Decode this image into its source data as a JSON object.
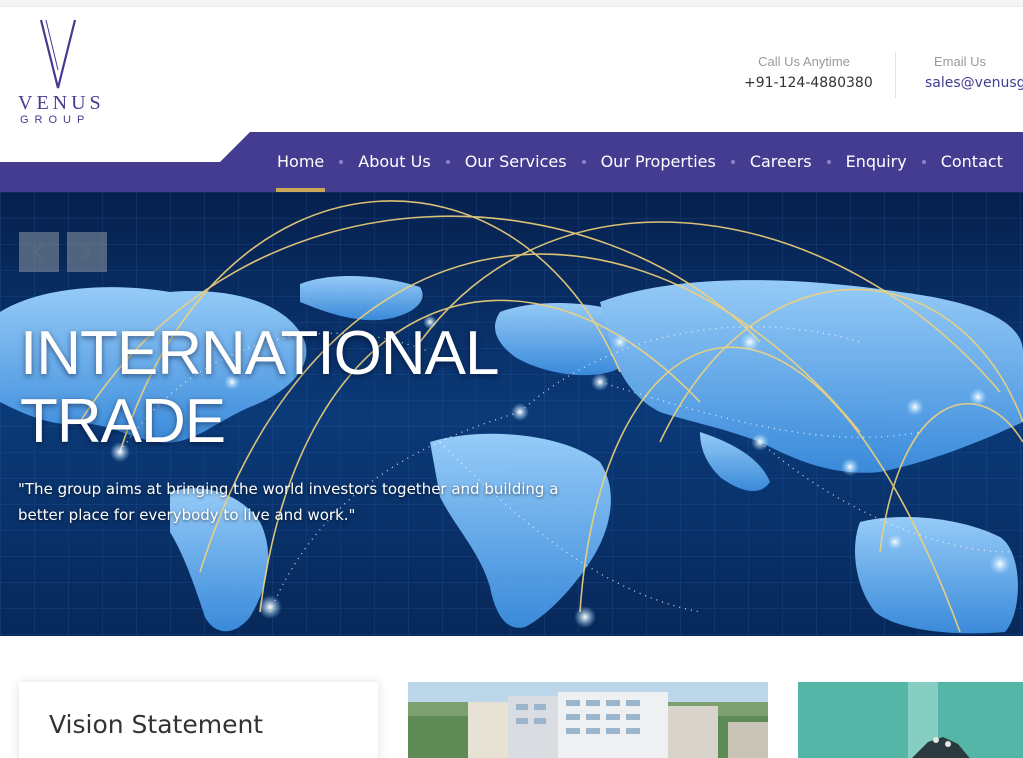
{
  "brand": {
    "logo_letter": "V",
    "name": "VENUS",
    "sub": "GROUP",
    "color": "#433c90"
  },
  "contact": {
    "phone_label": "Call Us Anytime",
    "phone": "+91-124-4880380",
    "email_label": "Email Us",
    "email": "sales@venusg"
  },
  "nav": {
    "items": [
      {
        "label": "Home",
        "active": true
      },
      {
        "label": "About Us"
      },
      {
        "label": "Our Services"
      },
      {
        "label": "Our Properties"
      },
      {
        "label": "Careers"
      },
      {
        "label": "Enquiry"
      },
      {
        "label": "Contact"
      }
    ],
    "bar_color": "#433c90",
    "active_underline_color": "#c9a85a"
  },
  "hero": {
    "title_line1": "INTERNATIONAL",
    "title_line2": "TRADE",
    "quote": "\"The group aims at bringing the world investors together and building a better place for everybody to live and work.\"",
    "prev_icon": "chevron-left-icon",
    "next_icon": "chevron-right-icon"
  },
  "cards": {
    "vision_title": "Vision Statement"
  }
}
